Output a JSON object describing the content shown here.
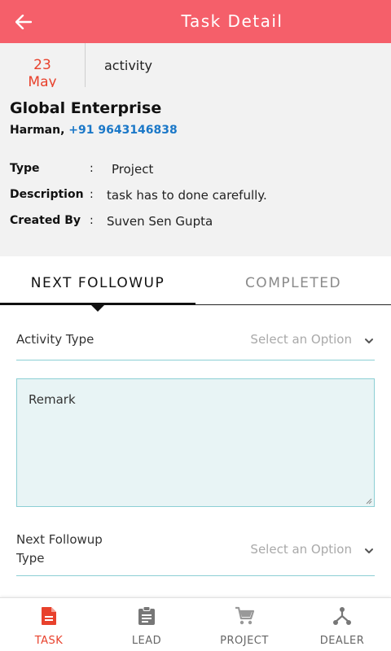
{
  "header": {
    "title": "Task Detail",
    "back_icon": "arrow-left-icon",
    "color": "#f55f6a"
  },
  "task": {
    "date_day": "23",
    "date_month": "May",
    "activity": "activity",
    "company": "Global Enterprise",
    "contact_name": "Harman,",
    "contact_phone": "+91 9643146838",
    "details": [
      {
        "label": "Type",
        "sep": ":",
        "value": "Project"
      },
      {
        "label": "Description",
        "sep": ":",
        "value": "task has to done carefully."
      },
      {
        "label": "Created By",
        "sep": ":",
        "value": "Suven Sen Gupta"
      }
    ]
  },
  "tabs": [
    {
      "label": "NEXT FOLLOWUP",
      "active": true
    },
    {
      "label": "COMPLETED",
      "active": false
    }
  ],
  "form": {
    "activity_type": {
      "label": "Activity Type",
      "placeholder": "Select an Option"
    },
    "remark": {
      "placeholder": "Remark"
    },
    "next_followup_type": {
      "label": "Next Followup Type",
      "label_line1": "Next Followup",
      "label_line2": "Type",
      "placeholder": "Select an Option"
    }
  },
  "bottom_nav": [
    {
      "label": "TASK",
      "icon": "task-document-icon",
      "active": true
    },
    {
      "label": "LEAD",
      "icon": "clipboard-icon",
      "active": false
    },
    {
      "label": "PROJECT",
      "icon": "cart-icon",
      "active": false
    },
    {
      "label": "DEALER",
      "icon": "network-icon",
      "active": false
    }
  ],
  "colors": {
    "accent": "#e8412c",
    "link": "#1b78c8",
    "input_border": "#8ccfd4",
    "remark_bg": "#e8f4f5"
  }
}
